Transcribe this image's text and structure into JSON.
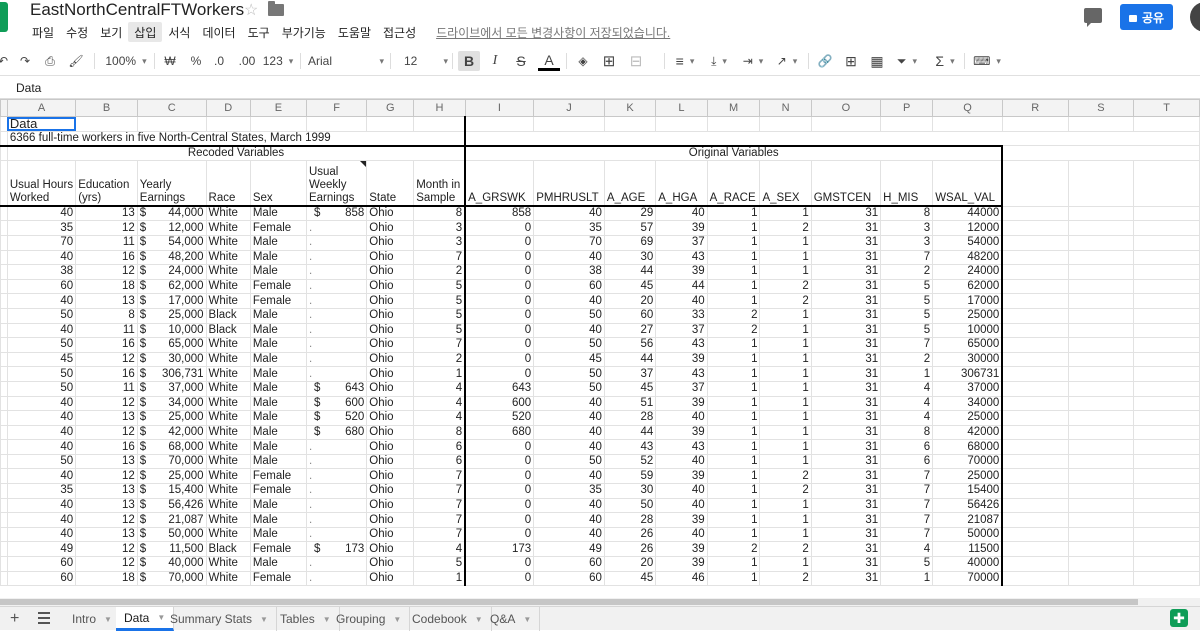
{
  "title": "EastNorthCentralFTWorkers",
  "menu": [
    "파일",
    "수정",
    "보기",
    "삽입",
    "서식",
    "데이터",
    "도구",
    "부가기능",
    "도움말",
    "접근성"
  ],
  "save_status": "드라이브에서 모든 변경사항이 저장되었습니다.",
  "share_label": "공유",
  "toolbar": {
    "zoom": "100%",
    "currency": "₩",
    "percent": "%",
    "dec_decrease": ".0",
    "dec_increase": ".00",
    "format": "123",
    "font": "Arial",
    "font_size": "12",
    "bold": "B",
    "italic": "I",
    "strike": "S",
    "text_color": "A",
    "sum": "Σ"
  },
  "formula_value": "Data",
  "columns": [
    "A",
    "B",
    "C",
    "D",
    "E",
    "F",
    "G",
    "H",
    "I",
    "J",
    "K",
    "L",
    "M",
    "N",
    "O",
    "P",
    "Q",
    "R",
    "S",
    "T"
  ],
  "sheet": {
    "title": "Data",
    "subtitle": "6366 full-time workers in five North-Central States, March 1999",
    "group_recoded": "Recoded Variables",
    "group_original": "Original Variables",
    "headers": [
      "Usual Hours Worked",
      "Education (yrs)",
      "Yearly Earnings",
      "Race",
      "Sex",
      "Usual Weekly Earnings",
      "State",
      "Month in Sample",
      "A_GRSWK",
      "PMHRUSLT",
      "A_AGE",
      "A_HGA",
      "A_RACE",
      "A_SEX",
      "GMSTCEN",
      "H_MIS",
      "WSAL_VAL"
    ],
    "rows": [
      [
        "40",
        "13",
        "44,000",
        "White",
        "Male",
        "858",
        "Ohio",
        "8",
        "858",
        "40",
        "29",
        "40",
        "1",
        "1",
        "31",
        "8",
        "44000"
      ],
      [
        "35",
        "12",
        "12,000",
        "White",
        "Female",
        ".",
        "Ohio",
        "3",
        "0",
        "35",
        "57",
        "39",
        "1",
        "2",
        "31",
        "3",
        "12000"
      ],
      [
        "70",
        "11",
        "54,000",
        "White",
        "Male",
        ".",
        "Ohio",
        "3",
        "0",
        "70",
        "69",
        "37",
        "1",
        "1",
        "31",
        "3",
        "54000"
      ],
      [
        "40",
        "16",
        "48,200",
        "White",
        "Male",
        ".",
        "Ohio",
        "7",
        "0",
        "40",
        "30",
        "43",
        "1",
        "1",
        "31",
        "7",
        "48200"
      ],
      [
        "38",
        "12",
        "24,000",
        "White",
        "Male",
        ".",
        "Ohio",
        "2",
        "0",
        "38",
        "44",
        "39",
        "1",
        "1",
        "31",
        "2",
        "24000"
      ],
      [
        "60",
        "18",
        "62,000",
        "White",
        "Female",
        ".",
        "Ohio",
        "5",
        "0",
        "60",
        "45",
        "44",
        "1",
        "2",
        "31",
        "5",
        "62000"
      ],
      [
        "40",
        "13",
        "17,000",
        "White",
        "Female",
        ".",
        "Ohio",
        "5",
        "0",
        "40",
        "20",
        "40",
        "1",
        "2",
        "31",
        "5",
        "17000"
      ],
      [
        "50",
        "8",
        "25,000",
        "Black",
        "Male",
        ".",
        "Ohio",
        "5",
        "0",
        "50",
        "60",
        "33",
        "2",
        "1",
        "31",
        "5",
        "25000"
      ],
      [
        "40",
        "11",
        "10,000",
        "Black",
        "Male",
        ".",
        "Ohio",
        "5",
        "0",
        "40",
        "27",
        "37",
        "2",
        "1",
        "31",
        "5",
        "10000"
      ],
      [
        "50",
        "16",
        "65,000",
        "White",
        "Male",
        ".",
        "Ohio",
        "7",
        "0",
        "50",
        "56",
        "43",
        "1",
        "1",
        "31",
        "7",
        "65000"
      ],
      [
        "45",
        "12",
        "30,000",
        "White",
        "Male",
        ".",
        "Ohio",
        "2",
        "0",
        "45",
        "44",
        "39",
        "1",
        "1",
        "31",
        "2",
        "30000"
      ],
      [
        "50",
        "16",
        "306,731",
        "White",
        "Male",
        ".",
        "Ohio",
        "1",
        "0",
        "50",
        "37",
        "43",
        "1",
        "1",
        "31",
        "1",
        "306731"
      ],
      [
        "50",
        "11",
        "37,000",
        "White",
        "Male",
        "643",
        "Ohio",
        "4",
        "643",
        "50",
        "45",
        "37",
        "1",
        "1",
        "31",
        "4",
        "37000"
      ],
      [
        "40",
        "12",
        "34,000",
        "White",
        "Male",
        "600",
        "Ohio",
        "4",
        "600",
        "40",
        "51",
        "39",
        "1",
        "1",
        "31",
        "4",
        "34000"
      ],
      [
        "40",
        "13",
        "25,000",
        "White",
        "Male",
        "520",
        "Ohio",
        "4",
        "520",
        "40",
        "28",
        "40",
        "1",
        "1",
        "31",
        "4",
        "25000"
      ],
      [
        "40",
        "12",
        "42,000",
        "White",
        "Male",
        "680",
        "Ohio",
        "8",
        "680",
        "40",
        "44",
        "39",
        "1",
        "1",
        "31",
        "8",
        "42000"
      ],
      [
        "40",
        "16",
        "68,000",
        "White",
        "Male",
        ".",
        "Ohio",
        "6",
        "0",
        "40",
        "43",
        "43",
        "1",
        "1",
        "31",
        "6",
        "68000"
      ],
      [
        "50",
        "13",
        "70,000",
        "White",
        "Male",
        ".",
        "Ohio",
        "6",
        "0",
        "50",
        "52",
        "40",
        "1",
        "1",
        "31",
        "6",
        "70000"
      ],
      [
        "40",
        "12",
        "25,000",
        "White",
        "Female",
        ".",
        "Ohio",
        "7",
        "0",
        "40",
        "59",
        "39",
        "1",
        "2",
        "31",
        "7",
        "25000"
      ],
      [
        "35",
        "13",
        "15,400",
        "White",
        "Female",
        ".",
        "Ohio",
        "7",
        "0",
        "35",
        "30",
        "40",
        "1",
        "2",
        "31",
        "7",
        "15400"
      ],
      [
        "40",
        "13",
        "56,426",
        "White",
        "Male",
        ".",
        "Ohio",
        "7",
        "0",
        "40",
        "50",
        "40",
        "1",
        "1",
        "31",
        "7",
        "56426"
      ],
      [
        "40",
        "12",
        "21,087",
        "White",
        "Male",
        ".",
        "Ohio",
        "7",
        "0",
        "40",
        "28",
        "39",
        "1",
        "1",
        "31",
        "7",
        "21087"
      ],
      [
        "40",
        "13",
        "50,000",
        "White",
        "Male",
        ".",
        "Ohio",
        "7",
        "0",
        "40",
        "26",
        "40",
        "1",
        "1",
        "31",
        "7",
        "50000"
      ],
      [
        "49",
        "12",
        "11,500",
        "Black",
        "Female",
        "173",
        "Ohio",
        "4",
        "173",
        "49",
        "26",
        "39",
        "2",
        "2",
        "31",
        "4",
        "11500"
      ],
      [
        "60",
        "12",
        "40,000",
        "White",
        "Male",
        ".",
        "Ohio",
        "5",
        "0",
        "60",
        "20",
        "39",
        "1",
        "1",
        "31",
        "5",
        "40000"
      ],
      [
        "60",
        "18",
        "70,000",
        "White",
        "Female",
        ".",
        "Ohio",
        "1",
        "0",
        "60",
        "45",
        "46",
        "1",
        "2",
        "31",
        "1",
        "70000"
      ]
    ]
  },
  "tabs": [
    {
      "label": "Intro",
      "active": false
    },
    {
      "label": "Data",
      "active": true
    },
    {
      "label": "Summary Stats",
      "active": false
    },
    {
      "label": "Tables",
      "active": false
    },
    {
      "label": "Grouping",
      "active": false
    },
    {
      "label": "Codebook",
      "active": false
    },
    {
      "label": "Q&A",
      "active": false
    }
  ]
}
